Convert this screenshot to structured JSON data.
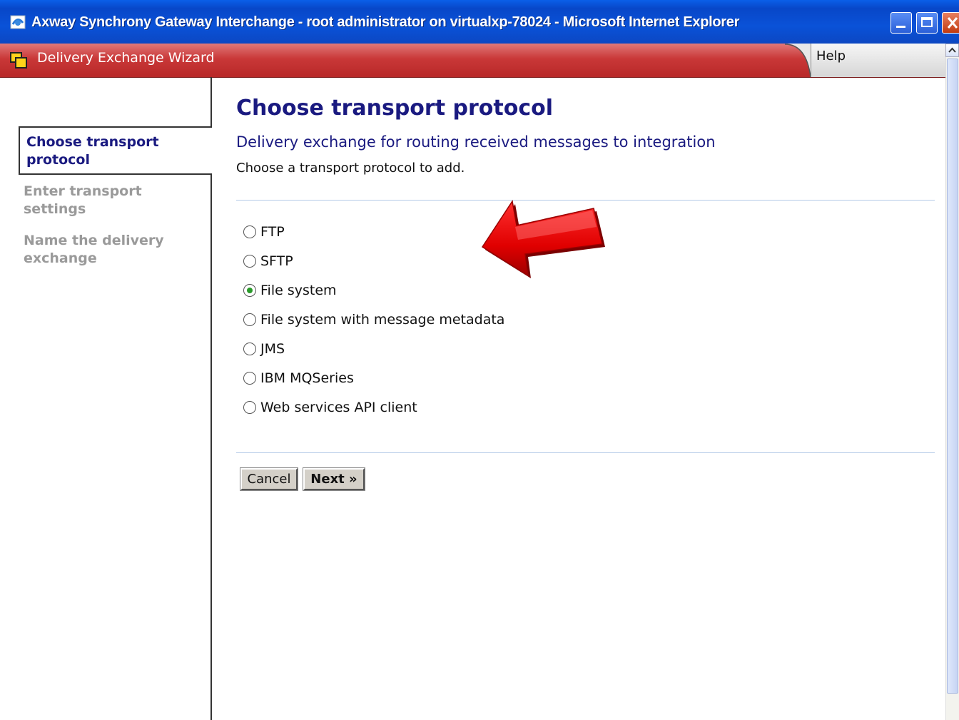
{
  "window": {
    "title": "Axway Synchrony Gateway Interchange - root administrator on virtualxp-78024 - Microsoft Internet Explorer"
  },
  "wizard": {
    "title": "Delivery Exchange Wizard",
    "help_label": "Help"
  },
  "nav": {
    "items": [
      {
        "label": "Choose transport protocol",
        "state": "active"
      },
      {
        "label": "Enter transport settings",
        "state": "inactive"
      },
      {
        "label": "Name the delivery exchange",
        "state": "inactive"
      }
    ]
  },
  "main": {
    "heading": "Choose transport protocol",
    "subheading": "Delivery exchange for routing received messages to integration",
    "instruction": "Choose a transport protocol to add.",
    "options": [
      {
        "label": "FTP",
        "selected": false
      },
      {
        "label": "SFTP",
        "selected": false
      },
      {
        "label": "File system",
        "selected": true
      },
      {
        "label": "File system with message metadata",
        "selected": false
      },
      {
        "label": "JMS",
        "selected": false
      },
      {
        "label": "IBM MQSeries",
        "selected": false
      },
      {
        "label": "Web services API client",
        "selected": false
      }
    ],
    "cancel_label": "Cancel",
    "next_label": "Next »"
  },
  "colors": {
    "titlebar": "#0a52d8",
    "wizard_bar": "#c93838",
    "heading": "#1a1a80",
    "arrow": "#e00000",
    "selected_radio": "#2a9a2a"
  }
}
